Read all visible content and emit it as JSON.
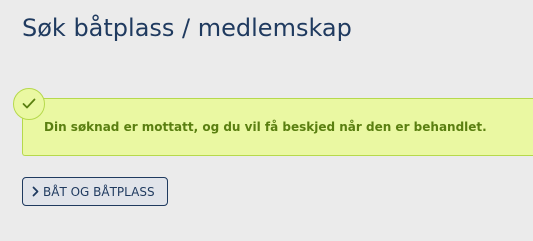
{
  "page": {
    "title": "Søk båtplass / medlemskap"
  },
  "alert": {
    "type": "success",
    "icon": "checkmark-icon",
    "message": "Din søknad er mottatt, og du vil få beskjed når den er behandlet."
  },
  "nav_button": {
    "icon": "chevron-right-icon",
    "label": "BÅT OG BÅTPLASS"
  },
  "colors": {
    "background": "#ebebeb",
    "title": "#1f3a5f",
    "alert_background": "#eaf8a2",
    "alert_border": "#b6d94c",
    "alert_text": "#5a7f10",
    "button_border": "#1f3a5f",
    "button_background": "#e1e4ea"
  }
}
